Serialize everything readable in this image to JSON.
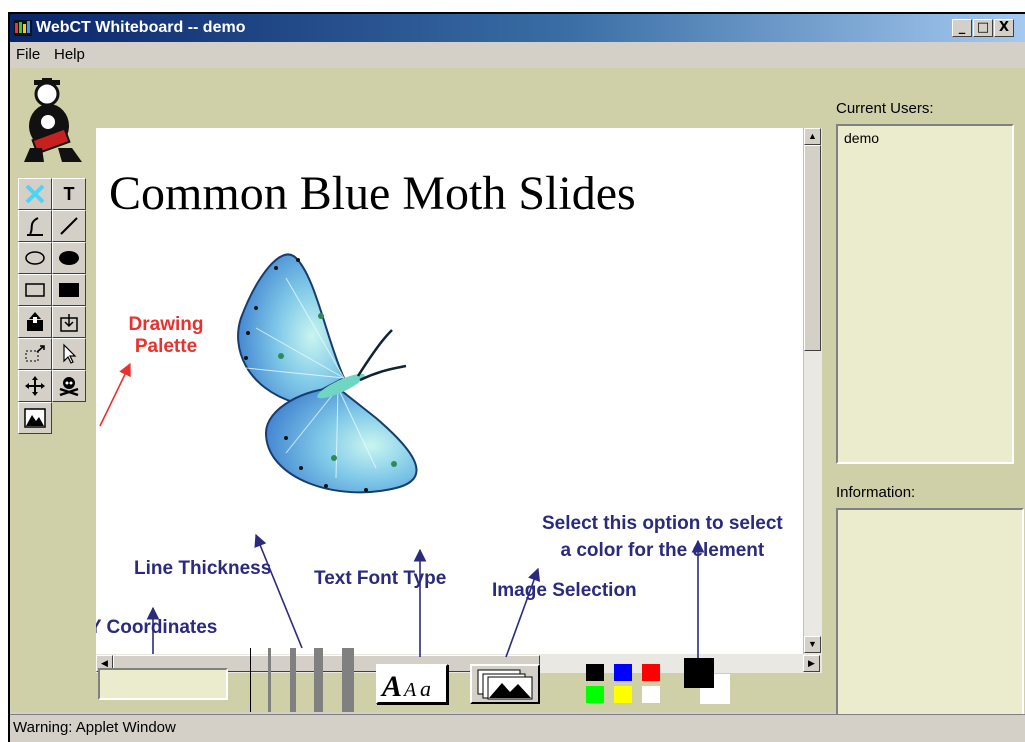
{
  "window": {
    "title": "WebCT Whiteboard -- demo",
    "controls": [
      "_",
      "□",
      "X"
    ]
  },
  "menu": {
    "items": [
      "File",
      "Help"
    ]
  },
  "canvas": {
    "slide_title": "Common Blue Moth Slides"
  },
  "annotations": {
    "drawing_palette_line1": "Drawing",
    "drawing_palette_line2": "Palette",
    "line_thickness": "Line Thickness",
    "text_font_type": "Text Font Type",
    "image_selection": "Image Selection",
    "xy_coordinates": "X, Y Coordinates",
    "color_line1": "Select this option to select",
    "color_line2": "a color for the element"
  },
  "palette": {
    "tools": [
      "clear",
      "text",
      "freehand",
      "line",
      "ellipse",
      "filled-ellipse",
      "rectangle",
      "filled-rectangle",
      "upload",
      "download",
      "resize",
      "select",
      "move",
      "delete",
      "image"
    ],
    "text_tool_label": "T"
  },
  "side_panel": {
    "current_users_label": "Current Users:",
    "users": [
      "demo"
    ],
    "information_label": "Information:"
  },
  "toolbar": {
    "coordinates_value": "",
    "color_swatches": [
      "#000000",
      "#0000ff",
      "#ff0000",
      "#00ff00",
      "#ffff00",
      "#ffffff"
    ],
    "foreground_color": "#000000",
    "background_color": "#ffffff"
  },
  "status": {
    "text": "Warning: Applet Window"
  },
  "colors": {
    "annotation_blue": "#2a2a7e",
    "annotation_red": "#e8322e",
    "pane_bg": "#cfcfa8",
    "panel_bg": "#ebebcd"
  }
}
